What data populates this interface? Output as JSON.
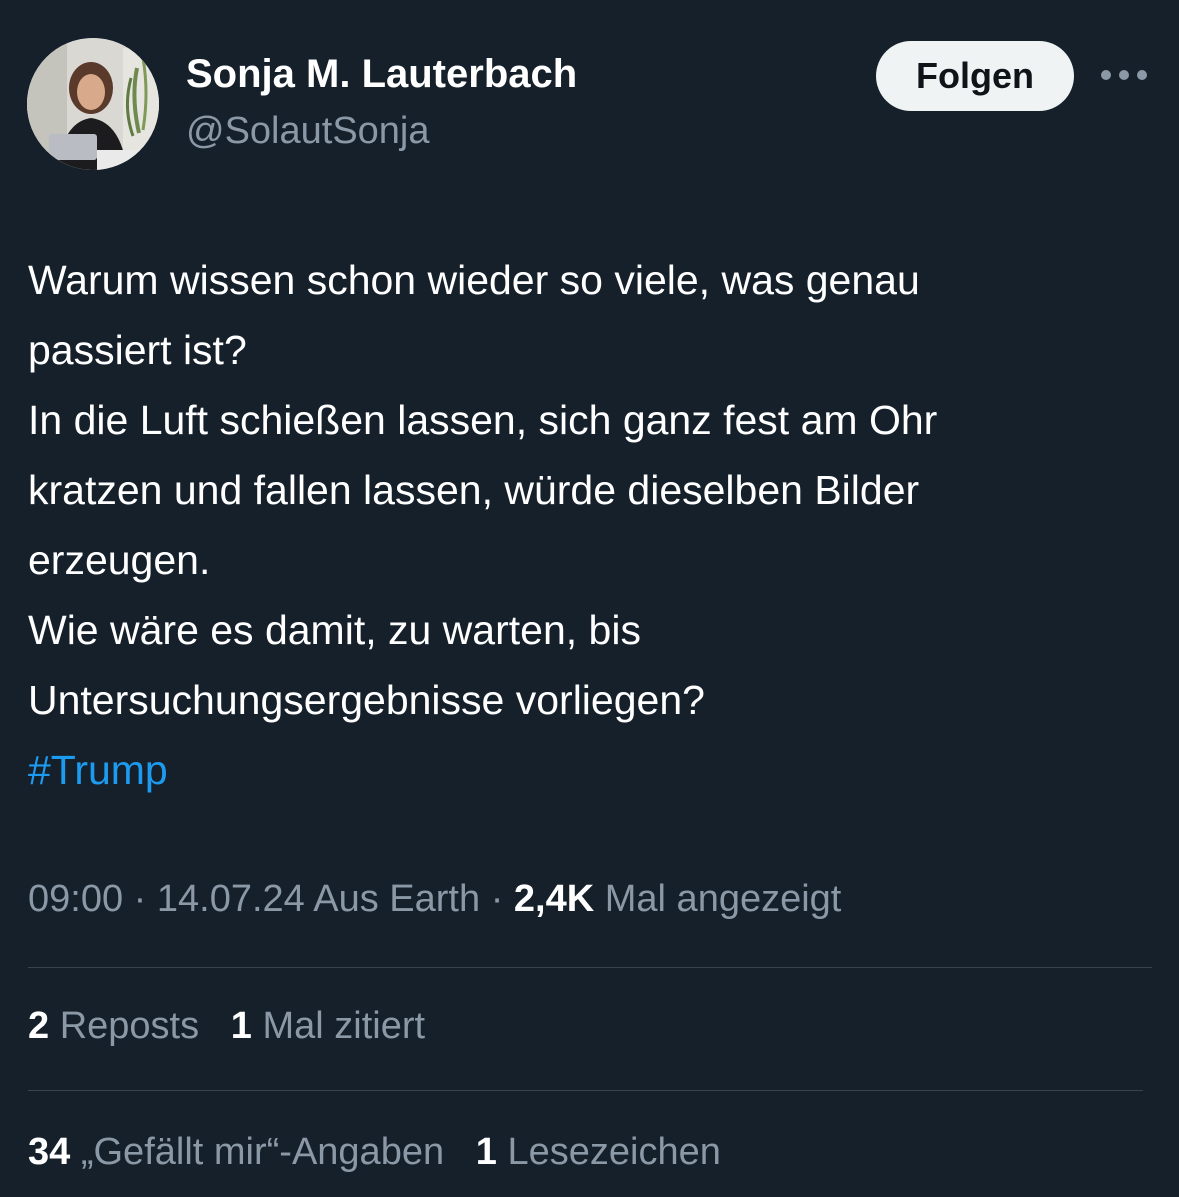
{
  "author": {
    "display_name": "Sonja M. Lauterbach",
    "handle": "@SolautSonja"
  },
  "actions": {
    "follow_label": "Folgen",
    "more_icon": "more-horizontal-icon"
  },
  "tweet": {
    "lines": [
      "Warum wissen schon wieder so viele, was genau",
      "passiert ist?",
      "In die Luft schießen lassen, sich ganz fest am Ohr",
      "kratzen und fallen lassen, würde dieselben Bilder",
      "erzeugen.",
      "Wie wäre es damit, zu warten, bis",
      "Untersuchungsergebnisse vorliegen?"
    ],
    "hashtag": "#Trump"
  },
  "meta": {
    "time": "09:00",
    "separator": "·",
    "date": "14.07.24",
    "source": "Aus Earth",
    "views_count": "2,4K",
    "views_label": "Mal angezeigt"
  },
  "stats": {
    "reposts_count": "2",
    "reposts_label": "Reposts",
    "quotes_count": "1",
    "quotes_label": "Mal zitiert",
    "likes_count": "34",
    "likes_label": "„Gefällt mir“-Angaben",
    "bookmarks_count": "1",
    "bookmarks_label": "Lesezeichen"
  },
  "colors": {
    "background": "#15202b",
    "text_primary": "#ffffff",
    "text_secondary": "#8b98a5",
    "link": "#1d9bf0",
    "button_bg": "#eff3f4",
    "divider": "#38444d"
  }
}
